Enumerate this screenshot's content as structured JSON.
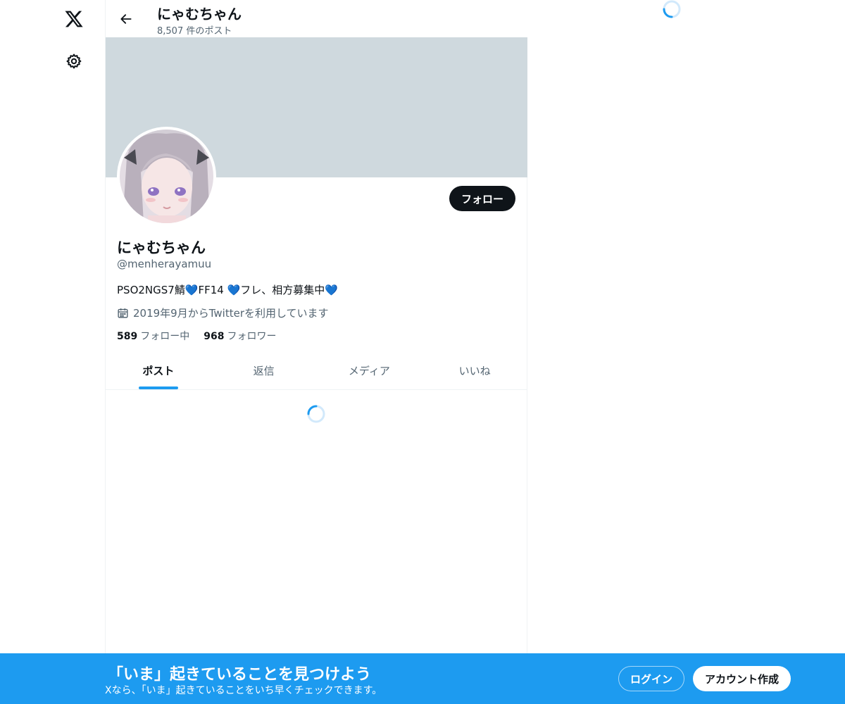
{
  "icons": {
    "logo": "x-logo-icon",
    "settings": "gear-icon",
    "back": "arrow-left-icon",
    "joined": "calendar-icon",
    "loading": "spinner-icon"
  },
  "header": {
    "name": "にゃむちゃん",
    "post_count": "8,507 件のポスト"
  },
  "profile": {
    "follow_label": "フォロー",
    "name": "にゃむちゃん",
    "handle": "@menherayamuu",
    "bio": "PSO2NGS7鯖💙FF14 💙フレ、相方募集中💙",
    "joined": "2019年9月からTwitterを利用しています",
    "following_count": "589",
    "following_label": "フォロー中",
    "followers_count": "968",
    "followers_label": "フォロワー"
  },
  "tabs": [
    {
      "label": "ポスト",
      "active": true
    },
    {
      "label": "返信",
      "active": false
    },
    {
      "label": "メディア",
      "active": false
    },
    {
      "label": "いいね",
      "active": false
    }
  ],
  "bottom_bar": {
    "title": "「いま」起きていることを見つけよう",
    "subtitle": "Xなら、「いま」起きていることをいち早くチェックできます。",
    "login_label": "ログイン",
    "signup_label": "アカウント作成"
  },
  "colors": {
    "accent": "#1d9bf0",
    "banner": "#cfd9de",
    "text_primary": "#0f1419",
    "text_secondary": "#536471"
  }
}
